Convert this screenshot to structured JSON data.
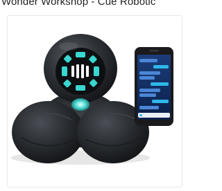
{
  "listing": {
    "title": "Wonder Workshop - Cue Robotic"
  },
  "product_image": {
    "alt": "Cue robot with smartphone app"
  },
  "colors": {
    "robot_body": "#2b2e33",
    "accent_teal": "#3ad6d0",
    "phone_body": "#1a1a1c",
    "phone_screen": "#0f2a5a"
  }
}
